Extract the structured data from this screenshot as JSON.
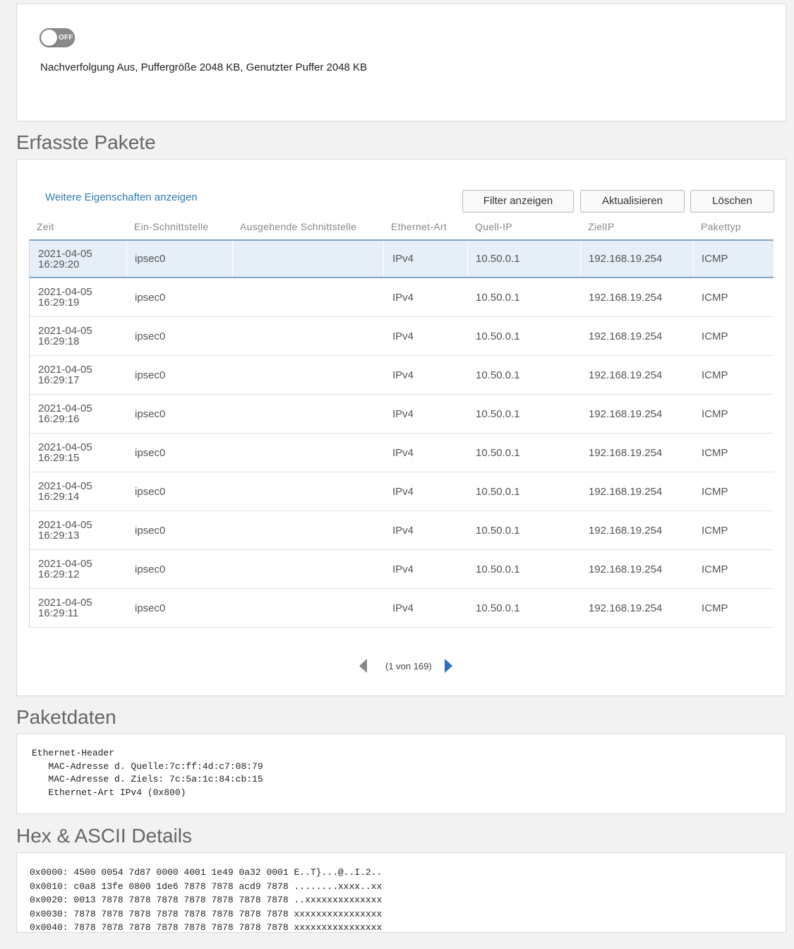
{
  "trace": {
    "toggle_label": "OFF",
    "status_text": "Nachverfolgung Aus, Puffergröße 2048 KB, Genutzter Puffer 2048 KB"
  },
  "packets": {
    "title": "Erfasste Pakete",
    "more_link": "Weitere Eigenschaften anzeigen",
    "buttons": {
      "filter": "Filter anzeigen",
      "refresh": "Aktualisieren",
      "delete": "Löschen"
    },
    "columns": [
      "Zeit",
      "Ein-Schnittstelle",
      "Ausgehende Schnittstelle",
      "Ethernet-Art",
      "Quell-IP",
      "ZielIP",
      "Pakettyp"
    ],
    "rows": [
      {
        "date": "2021-04-05",
        "time": "16:29:20",
        "in_if": "ipsec0",
        "out_if": "",
        "eth": "IPv4",
        "src": "10.50.0.1",
        "dst": "192.168.19.254",
        "type": "ICMP"
      },
      {
        "date": "2021-04-05",
        "time": "16:29:19",
        "in_if": "ipsec0",
        "out_if": "",
        "eth": "IPv4",
        "src": "10.50.0.1",
        "dst": "192.168.19.254",
        "type": "ICMP"
      },
      {
        "date": "2021-04-05",
        "time": "16:29:18",
        "in_if": "ipsec0",
        "out_if": "",
        "eth": "IPv4",
        "src": "10.50.0.1",
        "dst": "192.168.19.254",
        "type": "ICMP"
      },
      {
        "date": "2021-04-05",
        "time": "16:29:17",
        "in_if": "ipsec0",
        "out_if": "",
        "eth": "IPv4",
        "src": "10.50.0.1",
        "dst": "192.168.19.254",
        "type": "ICMP"
      },
      {
        "date": "2021-04-05",
        "time": "16:29:16",
        "in_if": "ipsec0",
        "out_if": "",
        "eth": "IPv4",
        "src": "10.50.0.1",
        "dst": "192.168.19.254",
        "type": "ICMP"
      },
      {
        "date": "2021-04-05",
        "time": "16:29:15",
        "in_if": "ipsec0",
        "out_if": "",
        "eth": "IPv4",
        "src": "10.50.0.1",
        "dst": "192.168.19.254",
        "type": "ICMP"
      },
      {
        "date": "2021-04-05",
        "time": "16:29:14",
        "in_if": "ipsec0",
        "out_if": "",
        "eth": "IPv4",
        "src": "10.50.0.1",
        "dst": "192.168.19.254",
        "type": "ICMP"
      },
      {
        "date": "2021-04-05",
        "time": "16:29:13",
        "in_if": "ipsec0",
        "out_if": "",
        "eth": "IPv4",
        "src": "10.50.0.1",
        "dst": "192.168.19.254",
        "type": "ICMP"
      },
      {
        "date": "2021-04-05",
        "time": "16:29:12",
        "in_if": "ipsec0",
        "out_if": "",
        "eth": "IPv4",
        "src": "10.50.0.1",
        "dst": "192.168.19.254",
        "type": "ICMP"
      },
      {
        "date": "2021-04-05",
        "time": "16:29:11",
        "in_if": "ipsec0",
        "out_if": "",
        "eth": "IPv4",
        "src": "10.50.0.1",
        "dst": "192.168.19.254",
        "type": "ICMP"
      }
    ],
    "selected_row": 0,
    "pager_text": "(1 von 169)"
  },
  "packet_data": {
    "title": "Paketdaten",
    "lines": [
      "Ethernet-Header",
      "   MAC-Adresse d. Quelle:7c:ff:4d:c7:08:79",
      "   MAC-Adresse d. Ziels: 7c:5a:1c:84:cb:15",
      "   Ethernet-Art IPv4 (0x800)"
    ]
  },
  "hex": {
    "title": "Hex & ASCII Details",
    "lines": [
      "0x0000: 4500 0054 7d87 0000 4001 1e49 0a32 0001 E..T}...@..I.2..",
      "0x0010: c0a8 13fe 0800 1de6 7878 7878 acd9 7878 ........xxxx..xx",
      "0x0020: 0013 7878 7878 7878 7878 7878 7878 7878 ..xxxxxxxxxxxxxx",
      "0x0030: 7878 7878 7878 7878 7878 7878 7878 7878 xxxxxxxxxxxxxxxx",
      "0x0040: 7878 7878 7878 7878 7878 7878 7878 7878 xxxxxxxxxxxxxxxx"
    ]
  },
  "colors": {
    "link": "#2f7bb0",
    "selected_row": "#e6eef7",
    "next_arrow": "#2f6ec0"
  }
}
